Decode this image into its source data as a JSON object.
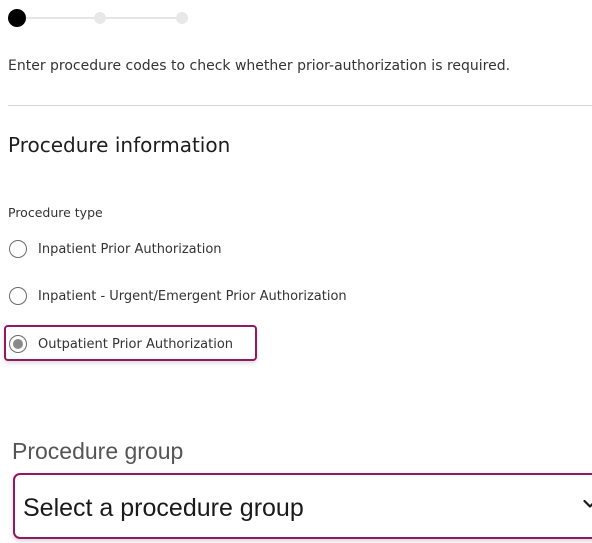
{
  "stepper": {
    "steps": [
      {
        "name": "step-1",
        "state": "active"
      },
      {
        "name": "step-2",
        "state": "pending"
      },
      {
        "name": "step-3",
        "state": "pending"
      }
    ]
  },
  "intro_text": "Enter procedure codes to check whether prior-authorization is required.",
  "section_title": "Procedure information",
  "procedure_type": {
    "label": "Procedure type",
    "options": [
      {
        "label": "Inpatient Prior Authorization",
        "checked": false
      },
      {
        "label": "Inpatient - Urgent/Emergent Prior Authorization",
        "checked": false
      },
      {
        "label": "Outpatient Prior Authorization",
        "checked": true
      }
    ]
  },
  "procedure_group": {
    "label": "Procedure group",
    "selected": "Select a procedure group"
  },
  "colors": {
    "highlight": "#8e1a60",
    "step_active": "#000000",
    "step_pending": "#e8e8e8"
  },
  "icons": {
    "select_icon": "chevron-down-icon"
  }
}
